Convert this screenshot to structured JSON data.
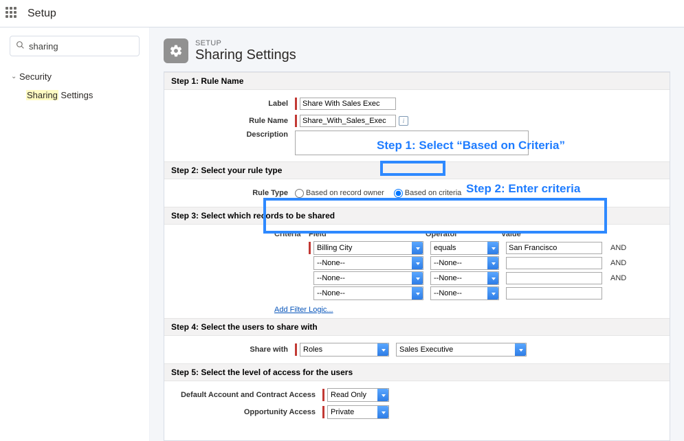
{
  "topbar": {
    "title": "Setup"
  },
  "sidebar": {
    "search_value": "sharing",
    "parent": "Security",
    "child_prefix": "Sharing",
    "child_suffix": " Settings"
  },
  "header": {
    "kicker": "SETUP",
    "title": "Sharing Settings"
  },
  "step1": {
    "heading": "Step 1: Rule Name",
    "label_lbl": "Label",
    "label_val": "Share With Sales Exec",
    "name_lbl": "Rule Name",
    "name_val": "Share_With_Sales_Exec",
    "desc_lbl": "Description",
    "desc_val": ""
  },
  "step2": {
    "heading": "Step 2: Select your rule type",
    "rule_type_lbl": "Rule Type",
    "opt_owner": "Based on record owner",
    "opt_criteria": "Based on criteria"
  },
  "step3": {
    "heading": "Step 3: Select which records to be shared",
    "criteria_lbl": "Criteria",
    "field_hdr": "Field",
    "op_hdr": "Operator",
    "val_hdr": "Value",
    "and": "AND",
    "rows": [
      {
        "field": "Billing City",
        "op": "equals",
        "val": "San Francisco"
      },
      {
        "field": "--None--",
        "op": "--None--",
        "val": ""
      },
      {
        "field": "--None--",
        "op": "--None--",
        "val": ""
      },
      {
        "field": "--None--",
        "op": "--None--",
        "val": ""
      }
    ],
    "add_filter": "Add Filter Logic..."
  },
  "step4": {
    "heading": "Step 4: Select the users to share with",
    "share_lbl": "Share with",
    "cat": "Roles",
    "val": "Sales Executive"
  },
  "step5": {
    "heading": "Step 5: Select the level of access for the users",
    "acct_lbl": "Default Account and Contract Access",
    "acct_val": "Read Only",
    "opp_lbl": "Opportunity Access",
    "opp_val": "Private"
  },
  "annotations": {
    "a1": "Step 1: Select “Based on Criteria”",
    "a2": "Step 2: Enter criteria"
  }
}
